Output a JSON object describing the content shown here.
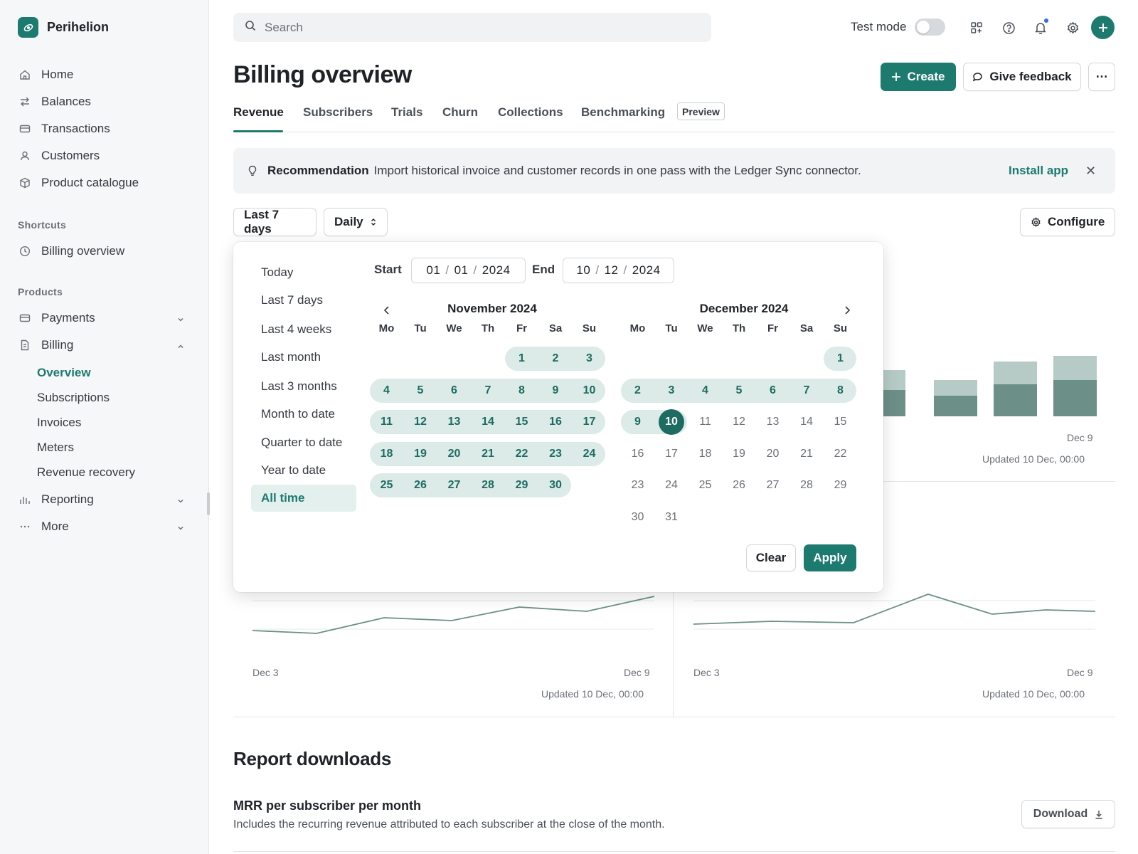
{
  "brand": {
    "name": "Perihelion"
  },
  "sidebar": {
    "main": [
      "Home",
      "Balances",
      "Transactions",
      "Customers",
      "Product catalogue"
    ],
    "shortcuts_label": "Shortcuts",
    "shortcuts": [
      "Billing overview"
    ],
    "products_label": "Products",
    "products": [
      "Payments",
      "Billing"
    ],
    "billing_sub": [
      "Overview",
      "Subscriptions",
      "Invoices",
      "Meters",
      "Revenue recovery"
    ],
    "bottom": [
      "Reporting",
      "More"
    ]
  },
  "topbar": {
    "search_placeholder": "Search",
    "test_mode_label": "Test mode"
  },
  "header": {
    "title": "Billing overview",
    "create_label": "Create",
    "feedback_label": "Give feedback",
    "more_label": "⋯"
  },
  "tabs": {
    "items": [
      "Revenue",
      "Subscribers",
      "Trials",
      "Churn",
      "Collections",
      "Benchmarking"
    ],
    "preview_badge": "Preview"
  },
  "banner": {
    "title": "Recommendation",
    "text": "Import historical invoice and customer records in one pass with the Ledger Sync connector.",
    "link": "Install app",
    "close": "✕"
  },
  "controls": {
    "range_label": "Last 7 days",
    "interval_label": "Daily",
    "configure_label": "Configure"
  },
  "charts": {
    "left": {
      "start": "Dec 3",
      "end": "Dec 9",
      "updated": "Updated 10 Dec, 00:00"
    },
    "right": {
      "start": "Dec 3",
      "end": "Dec 9",
      "updated": "Updated 10 Dec, 00:00"
    },
    "top_right": {
      "end": "Dec 9",
      "updated": "Updated 10 Dec, 00:00"
    }
  },
  "reports": {
    "title": "Report downloads",
    "item_title": "MRR per subscriber per month",
    "item_desc": "Includes the recurring revenue attributed to each subscriber at the close of the month.",
    "download_label": "Download"
  },
  "datepicker": {
    "presets": [
      "Today",
      "Last 7 days",
      "Last 4 weeks",
      "Last month",
      "Last 3 months",
      "Month to date",
      "Quarter to date",
      "Year to date",
      "All time"
    ],
    "active_preset": "All time",
    "start_label": "Start",
    "end_label": "End",
    "start": {
      "mm": "01",
      "dd": "01",
      "yyyy": "2024"
    },
    "end": {
      "mm": "10",
      "dd": "12",
      "yyyy": "2024"
    },
    "weekdays": [
      "Mo",
      "Tu",
      "We",
      "Th",
      "Fr",
      "Sa",
      "Su"
    ],
    "left_month": "November 2024",
    "right_month": "December 2024",
    "selected_day": "10",
    "clear_label": "Clear",
    "apply_label": "Apply"
  },
  "colors": {
    "accent": "#1d7a6f",
    "range_bg": "#dcebe8",
    "bar_dark": "#6c8f88",
    "bar_light": "#b6cbc6"
  }
}
